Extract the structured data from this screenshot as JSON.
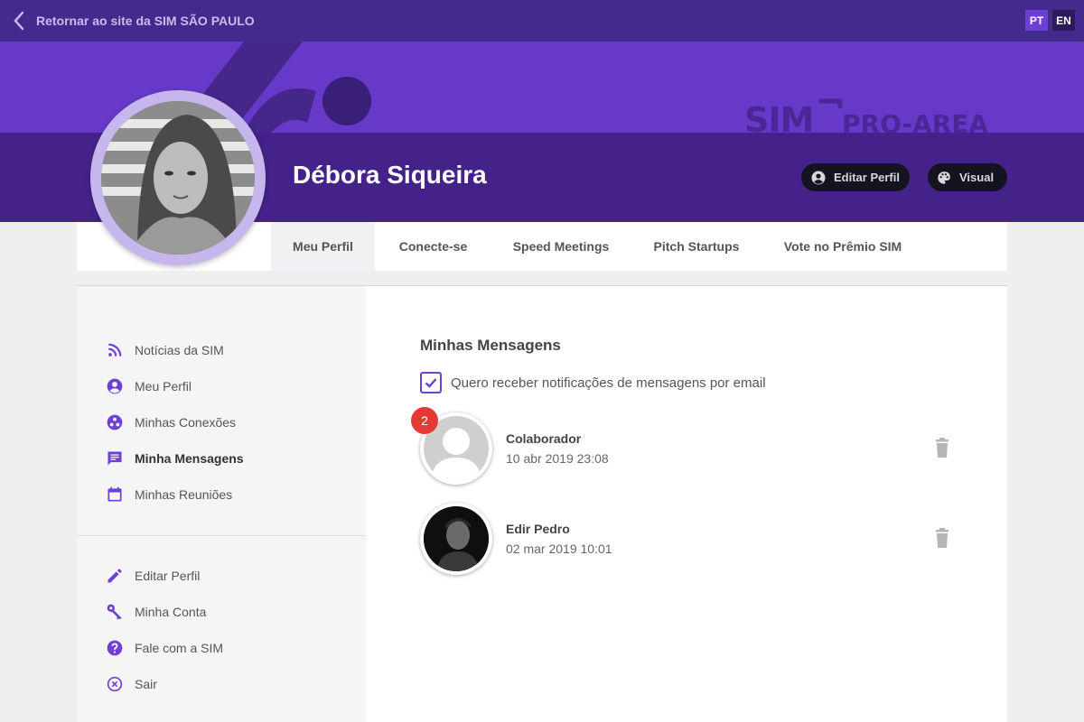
{
  "topbar": {
    "back_label": "Retornar ao site da SIM SÃO PAULO",
    "languages": [
      {
        "code": "PT",
        "active": true
      },
      {
        "code": "EN",
        "active": false
      }
    ]
  },
  "hero": {
    "brand_logo_text": "SIM PRO-AREA",
    "profile_name": "Débora Siqueira",
    "edit_profile_label": "Editar Perfil",
    "visual_label": "Visual"
  },
  "tabs": [
    {
      "label": "Meu Perfil",
      "active": true
    },
    {
      "label": "Conecte-se",
      "active": false
    },
    {
      "label": "Speed Meetings",
      "active": false
    },
    {
      "label": "Pitch Startups",
      "active": false
    },
    {
      "label": "Vote no Prêmio SIM",
      "active": false
    }
  ],
  "sidebar": {
    "primary": [
      {
        "label": "Notícias da SIM",
        "icon": "rss-icon"
      },
      {
        "label": "Meu Perfil",
        "icon": "account-circle-icon"
      },
      {
        "label": "Minhas Conexões",
        "icon": "connections-icon"
      },
      {
        "label": "Minha Mensagens",
        "icon": "message-icon",
        "active": true
      },
      {
        "label": "Minhas Reuniões",
        "icon": "calendar-icon"
      }
    ],
    "secondary": [
      {
        "label": "Editar Perfil",
        "icon": "pencil-icon"
      },
      {
        "label": "Minha Conta",
        "icon": "key-icon"
      },
      {
        "label": "Fale com a SIM",
        "icon": "help-icon"
      },
      {
        "label": "Sair",
        "icon": "close-circle-icon"
      }
    ]
  },
  "main": {
    "title": "Minhas Mensagens",
    "email_notification_label": "Quero receber notificações de mensagens por email",
    "email_notification_checked": true,
    "messages": [
      {
        "name": "Colaborador",
        "date": "10 abr 2019 23:08",
        "unread": "2"
      },
      {
        "name": "Edir Pedro",
        "date": "02 mar 2019 10:01",
        "unread": ""
      }
    ]
  },
  "colors": {
    "topbar": "#452a8e",
    "hero_light": "#6739c8",
    "hero_dark": "#45228a",
    "accent": "#6d3fd6",
    "badge": "#e53935"
  }
}
